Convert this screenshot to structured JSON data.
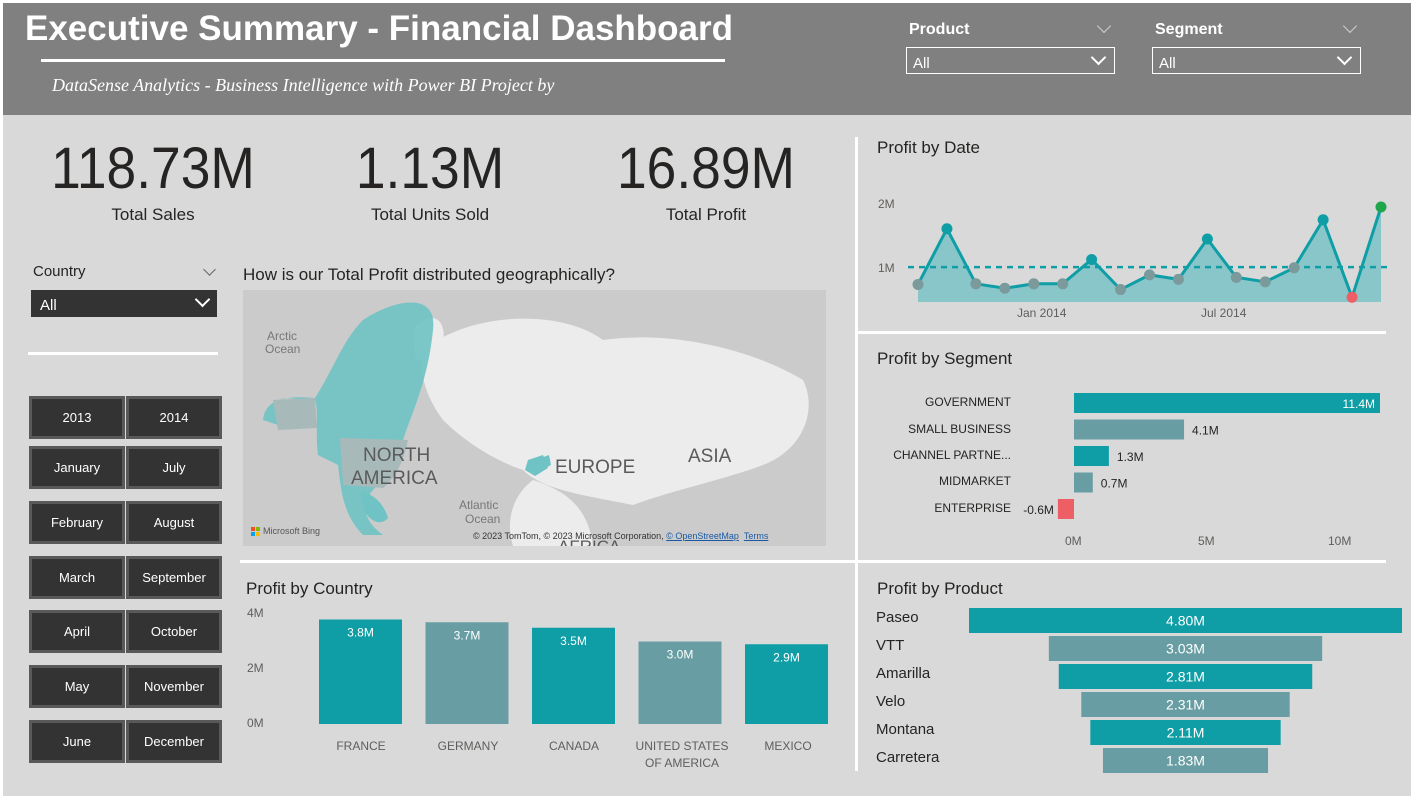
{
  "header": {
    "title": "Executive Summary - Financial Dashboard",
    "subtitle": "DataSense Analytics - Business Intelligence with Power BI Project by",
    "product_slicer": {
      "label": "Product",
      "value": "All"
    },
    "segment_slicer": {
      "label": "Segment",
      "value": "All"
    }
  },
  "kpis": [
    {
      "value": "118.73M",
      "label": "Total Sales"
    },
    {
      "value": "1.13M",
      "label": "Total Units Sold"
    },
    {
      "value": "16.89M",
      "label": "Total Profit"
    }
  ],
  "country_slicer": {
    "label": "Country",
    "value": "All"
  },
  "date_tiles": {
    "years": [
      "2013",
      "2014"
    ],
    "months": [
      "January",
      "July",
      "February",
      "August",
      "March",
      "September",
      "April",
      "October",
      "May",
      "November",
      "June",
      "December"
    ]
  },
  "map": {
    "title": "How is our Total Profit distributed geographically?",
    "labels": {
      "arctic": "Arctic\nOcean",
      "north_america": "NORTH\nAMERICA",
      "europe": "EUROPE",
      "asia": "ASIA",
      "atlantic": "Atlantic\nOcean",
      "africa": "AFRICA"
    },
    "credit_prefix": "© 2023 TomTom, © 2023 Microsoft Corporation,",
    "credit_osm": "© OpenStreetMap",
    "credit_terms": "Terms",
    "bing": "Microsoft Bing"
  },
  "colors": {
    "teal": "#0f9ea6",
    "gray_teal": "#689ea3",
    "negative": "#ee5f65",
    "max_point": "#20a64a"
  },
  "chart_data": [
    {
      "type": "area",
      "title": "Profit by Date",
      "x_ticks": [
        "Jan 2014",
        "Jul 2014"
      ],
      "y_ticks": [
        "1M",
        "2M"
      ],
      "ylim": [
        0,
        2.4
      ],
      "average_line": 1.06,
      "values": [
        0.79,
        1.66,
        0.8,
        0.73,
        0.8,
        0.8,
        1.18,
        0.71,
        0.94,
        0.87,
        1.5,
        0.9,
        0.83,
        1.05,
        1.8,
        0.59,
        2.0
      ],
      "x_positions": [
        0,
        1,
        2,
        3,
        4,
        5,
        6,
        7,
        8,
        9,
        10,
        11,
        12,
        13,
        14,
        15,
        16
      ],
      "min_index": 15,
      "max_index": 16
    },
    {
      "type": "bar",
      "orientation": "horizontal",
      "title": "Profit by Segment",
      "categories": [
        "GOVERNMENT",
        "SMALL BUSINESS",
        "CHANNEL PARTNE...",
        "MIDMARKET",
        "ENTERPRISE"
      ],
      "values": [
        11.4,
        4.1,
        1.3,
        0.7,
        -0.6
      ],
      "value_labels": [
        "11.4M",
        "4.1M",
        "1.3M",
        "0.7M",
        "-0.6M"
      ],
      "x_ticks": [
        "0M",
        "5M",
        "10M"
      ],
      "xlim": [
        -0.6,
        11.4
      ]
    },
    {
      "type": "bar",
      "title": "Profit by Country",
      "categories": [
        "FRANCE",
        "GERMANY",
        "CANADA",
        "UNITED STATES OF AMERICA",
        "MEXICO"
      ],
      "values": [
        3.8,
        3.7,
        3.5,
        3.0,
        2.9
      ],
      "value_labels": [
        "3.8M",
        "3.7M",
        "3.5M",
        "3.0M",
        "2.9M"
      ],
      "y_ticks": [
        "0M",
        "2M",
        "4M"
      ],
      "ylim": [
        0,
        4
      ]
    },
    {
      "type": "bar",
      "subtype": "funnel",
      "title": "Profit by Product",
      "categories": [
        "Paseo",
        "VTT",
        "Amarilla",
        "Velo",
        "Montana",
        "Carretera"
      ],
      "values": [
        4.8,
        3.03,
        2.81,
        2.31,
        2.11,
        1.83
      ],
      "value_labels": [
        "4.80M",
        "3.03M",
        "2.81M",
        "2.31M",
        "2.11M",
        "1.83M"
      ]
    }
  ]
}
